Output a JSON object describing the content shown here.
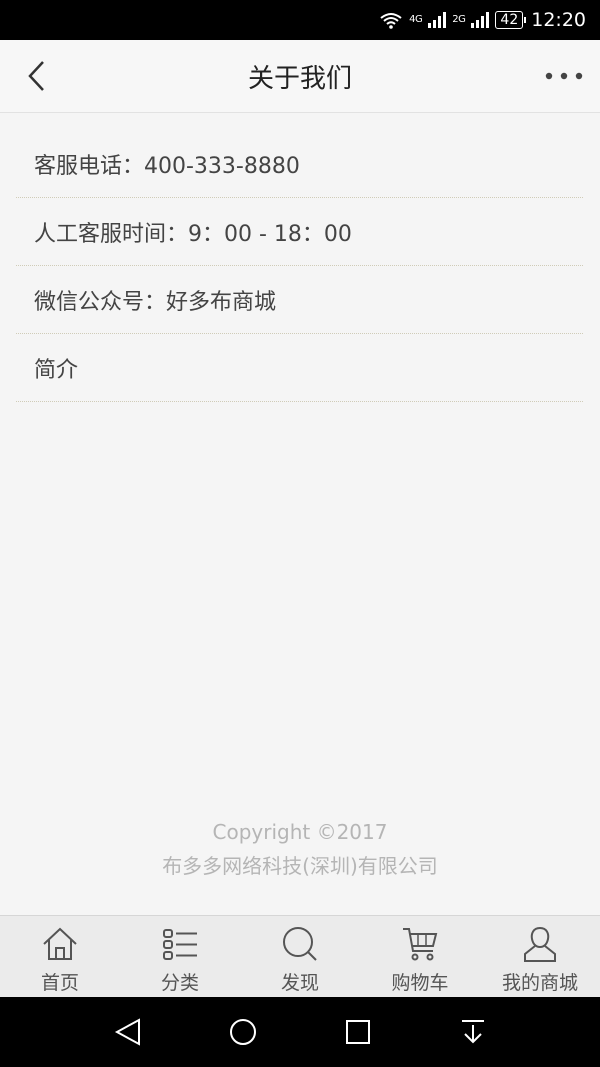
{
  "status_bar": {
    "net1": "4G",
    "net2": "2G",
    "net3": "2G",
    "battery": "42",
    "time": "12:20"
  },
  "header": {
    "title": "关于我们"
  },
  "info": [
    {
      "text": "客服电话：400-333-8880"
    },
    {
      "text": "人工客服时间：9：00 - 18：00"
    },
    {
      "text": "微信公众号：好多布商城"
    },
    {
      "text": "简介"
    }
  ],
  "footer": {
    "copyright": "Copyright ©2017",
    "company": "布多多网络科技(深圳)有限公司"
  },
  "tabs": [
    {
      "label": "首页",
      "icon": "home-icon"
    },
    {
      "label": "分类",
      "icon": "category-list-icon"
    },
    {
      "label": "发现",
      "icon": "search-icon"
    },
    {
      "label": "购物车",
      "icon": "cart-icon"
    },
    {
      "label": "我的商城",
      "icon": "user-icon"
    }
  ],
  "colors": {
    "header_bg": "#f7f7f7",
    "page_bg": "#f5f5f5",
    "tab_bg": "#ebebeb",
    "text": "#444444",
    "footer_text": "#b5b5b5"
  }
}
